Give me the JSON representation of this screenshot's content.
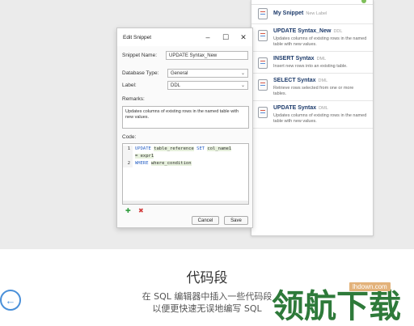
{
  "panel": {
    "items": [
      {
        "title": "My Snippet",
        "label": "New Label",
        "desc": ""
      },
      {
        "title": "UPDATE Syntax_New",
        "label": "DDL",
        "desc": "Updates columns of existing rows in the named table with new values."
      },
      {
        "title": "INSERT Syntax",
        "label": "DML",
        "desc": "Insert new rows into an existing table."
      },
      {
        "title": "SELECT Syntax",
        "label": "DML",
        "desc": "Retrieve rows selected from one or more tables."
      },
      {
        "title": "UPDATE Syntax",
        "label": "DML",
        "desc": "Updates columns of existing rows in the named table with new values."
      }
    ]
  },
  "dialog": {
    "title": "Edit Snippet",
    "minimize": "–",
    "maximize": "☐",
    "close": "✕",
    "name_label": "Snippet Name:",
    "name_value": "UPDATE Syntax_New",
    "dbtype_label": "Database Type:",
    "dbtype_value": "General",
    "label_label": "Label:",
    "label_value": "DDL",
    "remarks_label": "Remarks:",
    "remarks_value": "Updates columns of existing rows in the named table with new values.",
    "code_label": "Code:",
    "code": {
      "l1_no": "1",
      "l1_kw1": "UPDATE",
      "l1_t1": "table_reference",
      "l1_kw2": "SET",
      "l1_t2": "col_name1",
      "l1b_t": "= expr1",
      "l2_no": "2",
      "l2_kw": "WHERE",
      "l2_t": "where_condition"
    },
    "cancel": "Cancel",
    "save": "Save"
  },
  "caption": {
    "title": "代码段",
    "line1": "在 SQL 编辑器中插入一些代码段",
    "line2": "以便更快速无误地编写 SQL"
  },
  "watermark": {
    "text": "领航下载",
    "url": "lhdown.com"
  },
  "colors": {
    "accent": "#4a90d9",
    "keyword": "#2b63c6",
    "watermark": "#2e7a3a"
  }
}
